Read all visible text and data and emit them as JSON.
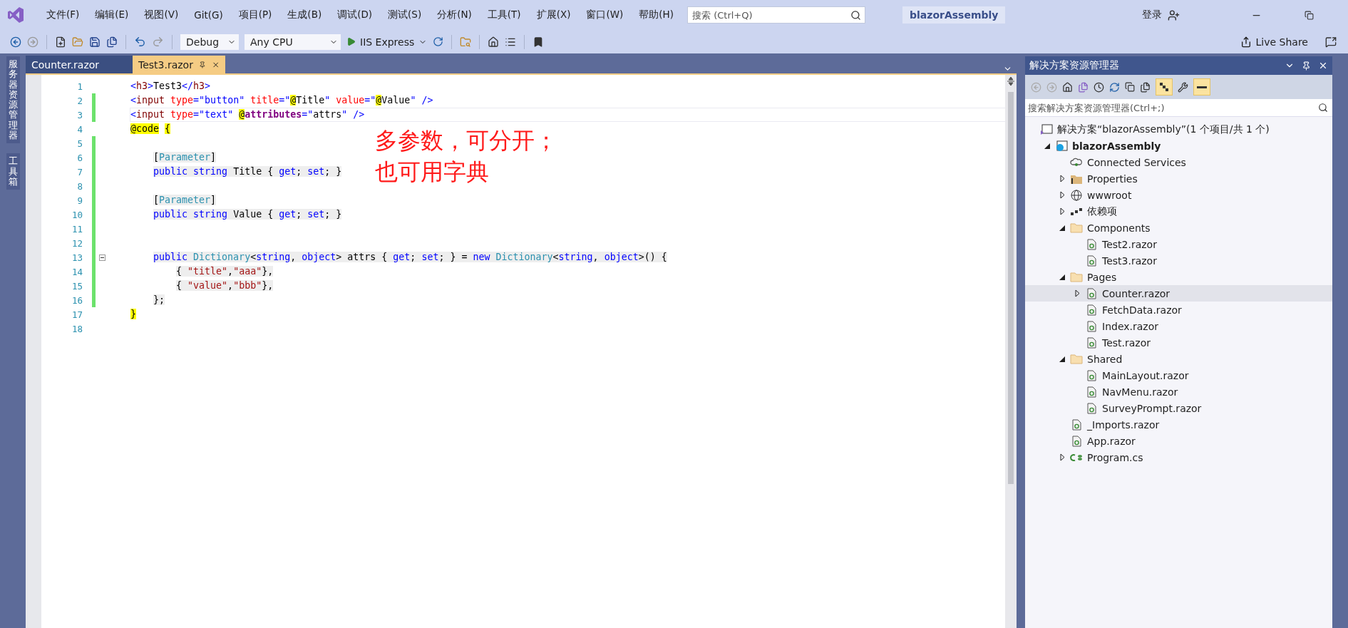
{
  "menu": [
    "文件(F)",
    "编辑(E)",
    "视图(V)",
    "Git(G)",
    "项目(P)",
    "生成(B)",
    "调试(D)",
    "测试(S)",
    "分析(N)",
    "工具(T)",
    "扩展(X)",
    "窗口(W)",
    "帮助(H)"
  ],
  "search": {
    "placeholder": "搜索 (Ctrl+Q)"
  },
  "solution_name": "blazorAssembly",
  "account": "登录",
  "toolbar": {
    "configuration": "Debug",
    "platform": "Any CPU",
    "run_target": "IIS Express",
    "live_share": "Live Share"
  },
  "left_tool_tabs": [
    "服务器资源管理器",
    "工具箱"
  ],
  "editor": {
    "tabs": [
      {
        "label": "Counter.razor",
        "selected": false
      },
      {
        "label": "Test3.razor",
        "selected": true
      }
    ],
    "lines": [
      {
        "number": "1",
        "changed": false,
        "current": false,
        "fold": false,
        "tokens": [
          {
            "kind": "delim",
            "text": "<"
          },
          {
            "kind": "tag",
            "text": "h3"
          },
          {
            "kind": "delim",
            "text": ">"
          },
          {
            "kind": "plain",
            "text": "Test3"
          },
          {
            "kind": "delim",
            "text": "</"
          },
          {
            "kind": "tag",
            "text": "h3"
          },
          {
            "kind": "delim",
            "text": ">"
          }
        ]
      },
      {
        "number": "2",
        "changed": true,
        "current": false,
        "fold": false,
        "tokens": [
          {
            "kind": "delim",
            "text": "<"
          },
          {
            "kind": "tag",
            "text": "input "
          },
          {
            "kind": "attr",
            "text": "type"
          },
          {
            "kind": "delim",
            "text": "="
          },
          {
            "kind": "str",
            "text": "\"button\" "
          },
          {
            "kind": "attr",
            "text": "title"
          },
          {
            "kind": "delim",
            "text": "=\""
          },
          {
            "kind": "at",
            "text": "@"
          },
          {
            "kind": "plain",
            "text": "Title"
          },
          {
            "kind": "delim",
            "text": "\" "
          },
          {
            "kind": "attr",
            "text": "value"
          },
          {
            "kind": "delim",
            "text": "=\""
          },
          {
            "kind": "at",
            "text": "@"
          },
          {
            "kind": "plain",
            "text": "Value"
          },
          {
            "kind": "delim",
            "text": "\" />"
          }
        ]
      },
      {
        "number": "3",
        "changed": true,
        "current": true,
        "fold": false,
        "tokens": [
          {
            "kind": "delim",
            "text": "<"
          },
          {
            "kind": "tag",
            "text": "input "
          },
          {
            "kind": "attr",
            "text": "type"
          },
          {
            "kind": "delim",
            "text": "="
          },
          {
            "kind": "str",
            "text": "\"text\" "
          },
          {
            "kind": "at",
            "text": "@"
          },
          {
            "kind": "directive",
            "text": "attributes"
          },
          {
            "kind": "delim",
            "text": "=\""
          },
          {
            "kind": "plain",
            "text": "attrs"
          },
          {
            "kind": "delim",
            "text": "\" />"
          }
        ]
      },
      {
        "number": "4",
        "changed": false,
        "current": false,
        "fold": false,
        "tokens": [
          {
            "kind": "hl",
            "text": "@code"
          },
          {
            "kind": "hl",
            "text": " {"
          }
        ]
      },
      {
        "number": "5",
        "changed": true,
        "current": false,
        "fold": false
      },
      {
        "number": "6",
        "changed": true,
        "current": false,
        "fold": false,
        "tokens": [
          {
            "kind": "cs",
            "text": "    ["
          },
          {
            "kind": "type",
            "text": "Parameter"
          },
          {
            "kind": "cs",
            "text": "]"
          }
        ]
      },
      {
        "number": "7",
        "changed": true,
        "current": false,
        "fold": false,
        "tokens": [
          {
            "kind": "kw",
            "text": "    public "
          },
          {
            "kind": "kw",
            "text": "string"
          },
          {
            "kind": "cs",
            "text": " Title { "
          },
          {
            "kind": "kw",
            "text": "get"
          },
          {
            "kind": "cs",
            "text": "; "
          },
          {
            "kind": "kw",
            "text": "set"
          },
          {
            "kind": "cs",
            "text": "; }"
          }
        ]
      },
      {
        "number": "8",
        "changed": true,
        "current": false,
        "fold": false
      },
      {
        "number": "9",
        "changed": true,
        "current": false,
        "fold": false,
        "tokens": [
          {
            "kind": "cs",
            "text": "    ["
          },
          {
            "kind": "type",
            "text": "Parameter"
          },
          {
            "kind": "cs",
            "text": "]"
          }
        ]
      },
      {
        "number": "10",
        "changed": true,
        "current": false,
        "fold": false,
        "tokens": [
          {
            "kind": "kw",
            "text": "    public "
          },
          {
            "kind": "kw",
            "text": "string"
          },
          {
            "kind": "cs",
            "text": " Value { "
          },
          {
            "kind": "kw",
            "text": "get"
          },
          {
            "kind": "cs",
            "text": "; "
          },
          {
            "kind": "kw",
            "text": "set"
          },
          {
            "kind": "cs",
            "text": "; }"
          }
        ]
      },
      {
        "number": "11",
        "changed": true,
        "current": false,
        "fold": false
      },
      {
        "number": "12",
        "changed": true,
        "current": false,
        "fold": false
      },
      {
        "number": "13",
        "changed": true,
        "current": false,
        "fold": true,
        "tokens": [
          {
            "kind": "kw",
            "text": "    public "
          },
          {
            "kind": "type",
            "text": "Dictionary"
          },
          {
            "kind": "cs",
            "text": "<"
          },
          {
            "kind": "kw",
            "text": "string"
          },
          {
            "kind": "cs",
            "text": ", "
          },
          {
            "kind": "kw",
            "text": "object"
          },
          {
            "kind": "cs",
            "text": "> attrs { "
          },
          {
            "kind": "kw",
            "text": "get"
          },
          {
            "kind": "cs",
            "text": "; "
          },
          {
            "kind": "kw",
            "text": "set"
          },
          {
            "kind": "cs",
            "text": "; } = "
          },
          {
            "kind": "kw",
            "text": "new "
          },
          {
            "kind": "type",
            "text": "Dictionary"
          },
          {
            "kind": "cs",
            "text": "<"
          },
          {
            "kind": "kw",
            "text": "string"
          },
          {
            "kind": "cs",
            "text": ", "
          },
          {
            "kind": "kw",
            "text": "object"
          },
          {
            "kind": "cs",
            "text": ">() {"
          }
        ]
      },
      {
        "number": "14",
        "changed": true,
        "current": false,
        "fold": false,
        "tokens": [
          {
            "kind": "cs",
            "text": "        { "
          },
          {
            "kind": "csstr",
            "text": "\"title\""
          },
          {
            "kind": "cs",
            "text": ","
          },
          {
            "kind": "csstr",
            "text": "\"aaa\""
          },
          {
            "kind": "cs",
            "text": "},"
          }
        ]
      },
      {
        "number": "15",
        "changed": true,
        "current": false,
        "fold": false,
        "tokens": [
          {
            "kind": "cs",
            "text": "        { "
          },
          {
            "kind": "csstr",
            "text": "\"value\""
          },
          {
            "kind": "cs",
            "text": ","
          },
          {
            "kind": "csstr",
            "text": "\"bbb\""
          },
          {
            "kind": "cs",
            "text": "},"
          }
        ]
      },
      {
        "number": "16",
        "changed": true,
        "current": false,
        "fold": false,
        "tokens": [
          {
            "kind": "cs",
            "text": "    };"
          }
        ]
      },
      {
        "number": "17",
        "changed": false,
        "current": false,
        "fold": false,
        "tokens": [
          {
            "kind": "hl",
            "text": "}"
          }
        ]
      },
      {
        "number": "18",
        "changed": false,
        "current": false,
        "fold": false
      }
    ],
    "annotation": [
      "多参数，可分开；",
      "也可用字典"
    ]
  },
  "solution_explorer": {
    "title": "解决方案资源管理器",
    "search": {
      "placeholder": "搜索解决方案资源管理器(Ctrl+;)"
    },
    "tree": [
      {
        "label": "解决方案“blazorAssembly”(1 个项目/共 1 个)",
        "kind": "solution",
        "selected": false,
        "children": [
          {
            "label": "blazorAssembly",
            "kind": "project",
            "expanded": true,
            "selected": false,
            "children": [
              {
                "label": "Connected Services",
                "kind": "connected",
                "selected": false
              },
              {
                "label": "Properties",
                "kind": "properties",
                "expanded": false,
                "selected": false
              },
              {
                "label": "wwwroot",
                "kind": "globe",
                "expanded": false,
                "selected": false
              },
              {
                "label": "依赖项",
                "kind": "deps",
                "expanded": false,
                "selected": false
              },
              {
                "label": "Components",
                "kind": "folder",
                "expanded": true,
                "selected": false,
                "children": [
                  {
                    "label": "Test2.razor",
                    "kind": "razor",
                    "selected": false
                  },
                  {
                    "label": "Test3.razor",
                    "kind": "razor",
                    "selected": false
                  }
                ]
              },
              {
                "label": "Pages",
                "kind": "folder",
                "expanded": true,
                "selected": false,
                "children": [
                  {
                    "label": "Counter.razor",
                    "kind": "razor",
                    "expanded": false,
                    "selected": true
                  },
                  {
                    "label": "FetchData.razor",
                    "kind": "razor",
                    "selected": false
                  },
                  {
                    "label": "Index.razor",
                    "kind": "razor",
                    "selected": false
                  },
                  {
                    "label": "Test.razor",
                    "kind": "razor",
                    "selected": false
                  }
                ]
              },
              {
                "label": "Shared",
                "kind": "folder",
                "expanded": true,
                "selected": false,
                "children": [
                  {
                    "label": "MainLayout.razor",
                    "kind": "razor",
                    "selected": false
                  },
                  {
                    "label": "NavMenu.razor",
                    "kind": "razor",
                    "selected": false
                  },
                  {
                    "label": "SurveyPrompt.razor",
                    "kind": "razor",
                    "selected": false
                  }
                ]
              },
              {
                "label": "_Imports.razor",
                "kind": "razor",
                "selected": false
              },
              {
                "label": "App.razor",
                "kind": "razor",
                "selected": false
              },
              {
                "label": "Program.cs",
                "kind": "csharp",
                "expanded": false,
                "selected": false
              }
            ]
          }
        ]
      }
    ]
  }
}
